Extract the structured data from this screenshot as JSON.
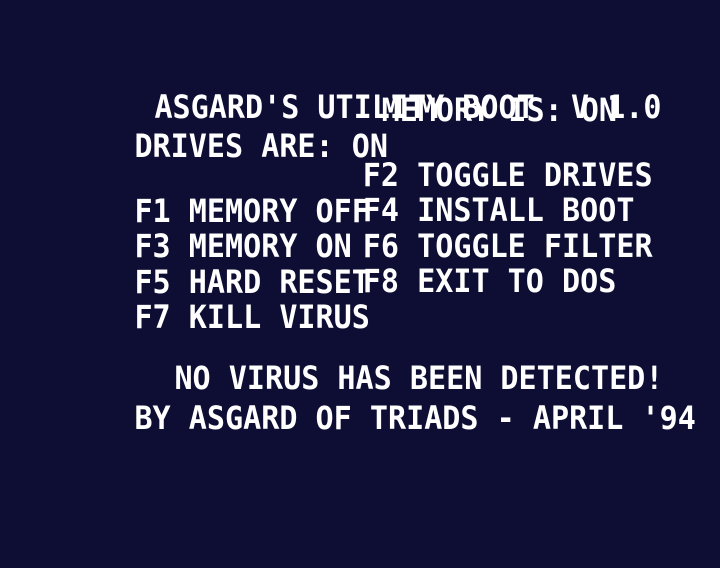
{
  "header": {
    "title": "ASGARD'S UTILITY BOOT  V 1.0",
    "drives_status": "DRIVES ARE: ON",
    "memory_status": "MEMORY IS: ON"
  },
  "menu": {
    "items": [
      {
        "key": "F1",
        "label": "MEMORY OFF"
      },
      {
        "key": "F2",
        "label": "TOGGLE DRIVES"
      },
      {
        "key": "F3",
        "label": "MEMORY ON"
      },
      {
        "key": "F4",
        "label": "INSTALL BOOT"
      },
      {
        "key": "F5",
        "label": "HARD RESET"
      },
      {
        "key": "F6",
        "label": "TOGGLE FILTER"
      },
      {
        "key": "F7",
        "label": "KILL VIRUS"
      },
      {
        "key": "F8",
        "label": "EXIT TO DOS"
      }
    ]
  },
  "status": {
    "message": "NO VIRUS HAS BEEN DETECTED!",
    "credits": "BY ASGARD OF TRIADS - APRIL '94"
  },
  "colors": {
    "background": "#0e0e34",
    "text": "#ffffff"
  }
}
